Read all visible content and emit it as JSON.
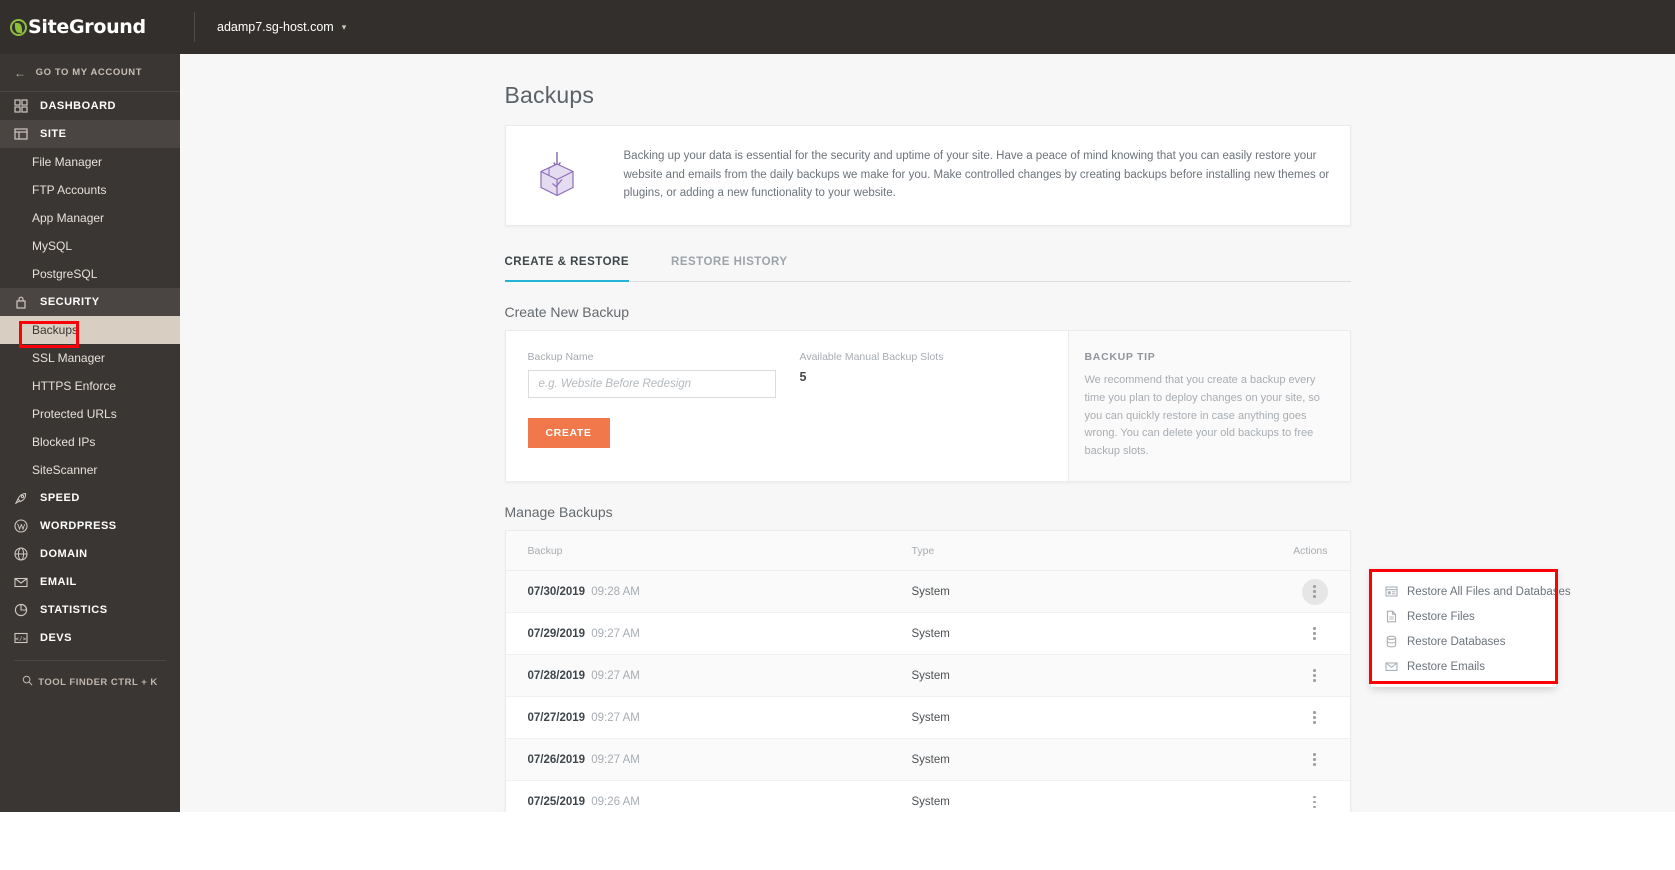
{
  "brand": {
    "name": "SiteGround",
    "accent": "#8bbf3c"
  },
  "sidebar": {
    "back_label": "GO TO MY ACCOUNT",
    "groups": [
      {
        "label": "DASHBOARD",
        "icon": "dashboard-icon"
      },
      {
        "label": "SITE",
        "icon": "site-icon"
      },
      {
        "label": "SECURITY",
        "icon": "lock-icon"
      },
      {
        "label": "SPEED",
        "icon": "speed-icon"
      },
      {
        "label": "WORDPRESS",
        "icon": "wordpress-icon"
      },
      {
        "label": "DOMAIN",
        "icon": "globe-icon"
      },
      {
        "label": "EMAIL",
        "icon": "envelope-icon"
      },
      {
        "label": "STATISTICS",
        "icon": "pie-chart-icon"
      },
      {
        "label": "DEVS",
        "icon": "code-icon"
      }
    ],
    "site_items": [
      "File Manager",
      "FTP Accounts",
      "App Manager",
      "MySQL",
      "PostgreSQL"
    ],
    "security_items": [
      "Backups",
      "SSL Manager",
      "HTTPS Enforce",
      "Protected URLs",
      "Blocked IPs",
      "SiteScanner"
    ],
    "active_item": "Backups",
    "tool_finder": "TOOL FINDER CTRL + K"
  },
  "topbar": {
    "site": "adamp7.sg-host.com",
    "chevron": "chevron-down-icon"
  },
  "page": {
    "title": "Backups"
  },
  "info": {
    "icon": "backup-box-icon",
    "text": "Backing up your data is essential for the security and uptime of your site. Have a peace of mind knowing that you can easily restore your website and emails from the daily backups we make for you. Make controlled changes by creating backups before installing new themes or plugins, or adding a new functionality to your website."
  },
  "tabs": [
    {
      "label": "CREATE & RESTORE",
      "active": true
    },
    {
      "label": "RESTORE HISTORY",
      "active": false
    }
  ],
  "create": {
    "section_title": "Create New Backup",
    "name_label": "Backup Name",
    "name_value": "",
    "name_placeholder": "e.g. Website Before Redesign",
    "slots_label": "Available Manual Backup Slots",
    "slots_value": "5",
    "button_label": "CREATE",
    "button_color": "#f1784b"
  },
  "tip": {
    "title": "BACKUP TIP",
    "body": "We recommend that you create a backup every time you plan to deploy changes on your site, so you can quickly restore in case anything goes wrong. You can delete your old backups to free backup slots."
  },
  "manage": {
    "section_title": "Manage Backups",
    "columns": {
      "backup": "Backup",
      "type": "Type",
      "actions": "Actions"
    },
    "rows": [
      {
        "date": "07/30/2019",
        "time": "09:28 AM",
        "type": "System",
        "menu_open": true
      },
      {
        "date": "07/29/2019",
        "time": "09:27 AM",
        "type": "System",
        "menu_open": false
      },
      {
        "date": "07/28/2019",
        "time": "09:27 AM",
        "type": "System",
        "menu_open": false
      },
      {
        "date": "07/27/2019",
        "time": "09:27 AM",
        "type": "System",
        "menu_open": false
      },
      {
        "date": "07/26/2019",
        "time": "09:27 AM",
        "type": "System",
        "menu_open": false
      },
      {
        "date": "07/25/2019",
        "time": "09:26 AM",
        "type": "System",
        "menu_open": false
      }
    ]
  },
  "dropdown": {
    "items": [
      {
        "label": "Restore All Files and Databases",
        "icon": "restore-all-icon"
      },
      {
        "label": "Restore Files",
        "icon": "file-icon"
      },
      {
        "label": "Restore Databases",
        "icon": "database-icon"
      },
      {
        "label": "Restore Emails",
        "icon": "envelope-icon"
      }
    ]
  },
  "annotations": {
    "color": "#fb0007"
  }
}
